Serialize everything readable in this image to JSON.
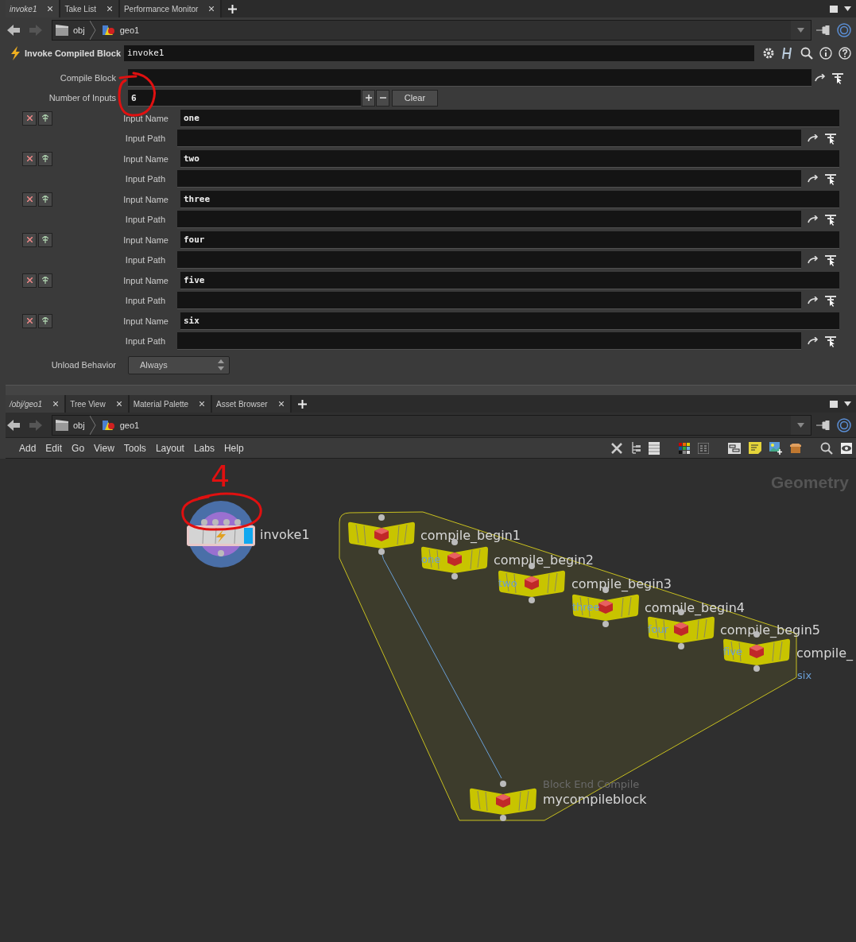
{
  "params_pane": {
    "tabs": [
      {
        "label": "invoke1",
        "selected": true
      },
      {
        "label": "Take List",
        "selected": false
      },
      {
        "label": "Performance Monitor",
        "selected": false
      }
    ],
    "path": [
      "obj",
      "geo1"
    ],
    "node_type": "Invoke Compiled Block",
    "node_name": "invoke1",
    "compile_block": {
      "label": "Compile Block"
    },
    "num_inputs": {
      "label": "Number of Inputs",
      "value": "6",
      "clear": "Clear"
    },
    "inputs": [
      {
        "name_label": "Input Name",
        "name": "one",
        "path_label": "Input Path"
      },
      {
        "name_label": "Input Name",
        "name": "two",
        "path_label": "Input Path"
      },
      {
        "name_label": "Input Name",
        "name": "three",
        "path_label": "Input Path"
      },
      {
        "name_label": "Input Name",
        "name": "four",
        "path_label": "Input Path"
      },
      {
        "name_label": "Input Name",
        "name": "five",
        "path_label": "Input Path"
      },
      {
        "name_label": "Input Name",
        "name": "six",
        "path_label": "Input Path"
      }
    ],
    "unload": {
      "label": "Unload Behavior",
      "value": "Always"
    }
  },
  "network_pane": {
    "tabs": [
      {
        "label": "/obj/geo1",
        "selected": true
      },
      {
        "label": "Tree View",
        "selected": false
      },
      {
        "label": "Material Palette",
        "selected": false
      },
      {
        "label": "Asset Browser",
        "selected": false
      }
    ],
    "path": [
      "obj",
      "geo1"
    ],
    "menu": [
      "Add",
      "Edit",
      "Go",
      "View",
      "Tools",
      "Layout",
      "Labs",
      "Help"
    ],
    "context_label": "Geometry",
    "nodes": [
      {
        "kind": "invoke",
        "name": "invoke1"
      },
      {
        "kind": "begin",
        "name": "compile_begin1"
      },
      {
        "kind": "begin",
        "name": "compile_begin2",
        "input_label": "one"
      },
      {
        "kind": "begin",
        "name": "compile_begin3",
        "input_label": "two"
      },
      {
        "kind": "begin",
        "name": "compile_begin4",
        "input_label": "three"
      },
      {
        "kind": "begin",
        "name": "compile_begin5",
        "input_label": "four"
      },
      {
        "kind": "begin",
        "name": "compile_",
        "input_label": "five",
        "output_label": "six"
      },
      {
        "kind": "end",
        "type_label": "Block End Compile",
        "name": "mycompileblock"
      }
    ]
  },
  "annotations": [
    {
      "kind": "circle"
    },
    {
      "kind": "stroke"
    },
    {
      "kind": "circle"
    },
    {
      "kind": "text",
      "text": "4"
    }
  ]
}
